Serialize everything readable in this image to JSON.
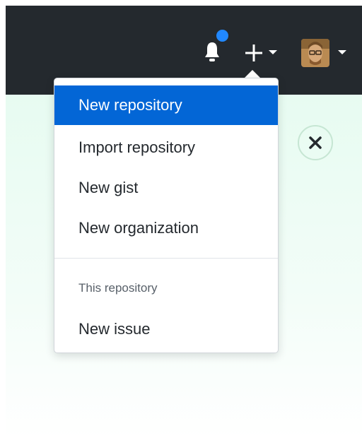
{
  "header": {
    "notifications_icon": "bell-icon",
    "notification_indicator_color": "#2188ff",
    "create_icon": "plus-icon",
    "user_menu_icon": "avatar"
  },
  "dropdown": {
    "items": [
      {
        "label": "New repository",
        "active": true
      },
      {
        "label": "Import repository"
      },
      {
        "label": "New gist"
      },
      {
        "label": "New organization"
      }
    ],
    "section_header": "This repository",
    "section_items": [
      {
        "label": "New issue"
      }
    ]
  },
  "colors": {
    "header_bg": "#24292e",
    "accent": "#0366d6",
    "content_bg": "#e7fbf1"
  },
  "dismiss_icon": "close-icon"
}
